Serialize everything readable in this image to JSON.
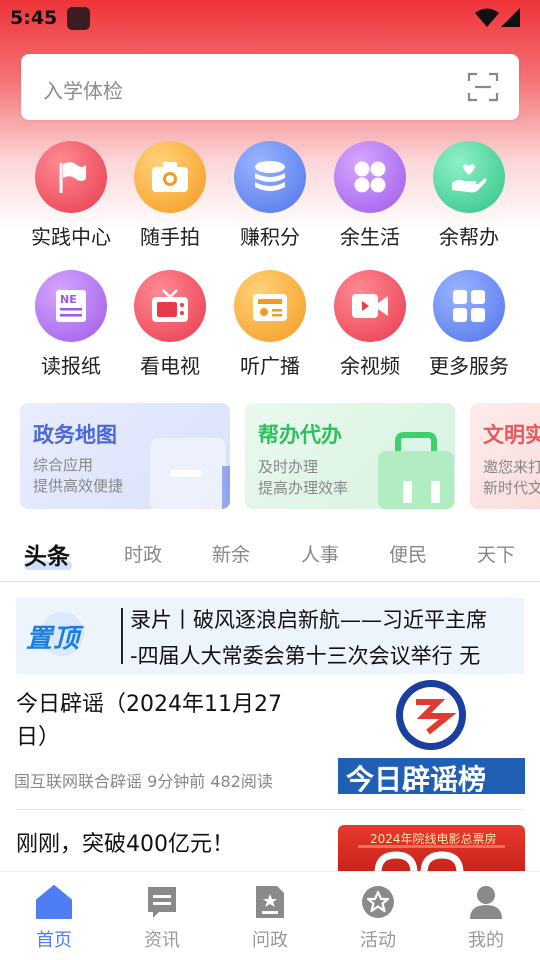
{
  "status_bar": {
    "time": "5:45"
  },
  "search": {
    "placeholder": "入学体检"
  },
  "services": [
    {
      "label": "实践中心",
      "icon": "flag-icon",
      "color": "#f0505f"
    },
    {
      "label": "随手拍",
      "icon": "camera-icon",
      "color": "#f9a932"
    },
    {
      "label": "赚积分",
      "icon": "coins-icon",
      "color": "#5c83f1"
    },
    {
      "label": "余生活",
      "icon": "clover-icon",
      "color": "#b06ff0"
    },
    {
      "label": "余帮办",
      "icon": "heart-hand-icon",
      "color": "#3fcf95"
    },
    {
      "label": "读报纸",
      "icon": "newspaper-icon",
      "color": "#b06ff0"
    },
    {
      "label": "看电视",
      "icon": "tv-icon",
      "color": "#f0505f"
    },
    {
      "label": "听广播",
      "icon": "radio-icon",
      "color": "#f9a932"
    },
    {
      "label": "余视频",
      "icon": "video-icon",
      "color": "#f0505f"
    },
    {
      "label": "更多服务",
      "icon": "grid-icon",
      "color": "#5c83f1"
    }
  ],
  "cards": [
    {
      "title": "政务地图",
      "sub1": "综合应用",
      "sub2": "提供高效便捷",
      "color": "#4a66d8"
    },
    {
      "title": "帮办代办",
      "sub1": "及时办理",
      "sub2": "提高办理效率",
      "color": "#2fbf5d"
    },
    {
      "title": "文明实",
      "sub1": "邀您来打",
      "sub2": "新时代文",
      "color": "#e55a5a"
    }
  ],
  "tabs": [
    "头条",
    "时政",
    "新余",
    "人事",
    "便民",
    "天下"
  ],
  "pinned": {
    "badge": "置顶",
    "line1": "录片丨破风逐浪启新航——习近平主席",
    "line2": "-四届人大常委会第十三次会议举行 无"
  },
  "news": [
    {
      "title": "今日辟谣（2024年11月27日）",
      "meta": "国互联网联合辟谣 9分钟前 482阅读",
      "image_caption": "今日辟谣榜"
    },
    {
      "title": "刚刚，突破400亿元！",
      "image_caption": "2024年院线电影总票房"
    }
  ],
  "bottom_nav": [
    {
      "label": "首页",
      "icon": "home-icon"
    },
    {
      "label": "资讯",
      "icon": "news-icon"
    },
    {
      "label": "问政",
      "icon": "inquiry-icon"
    },
    {
      "label": "活动",
      "icon": "activity-icon"
    },
    {
      "label": "我的",
      "icon": "profile-icon"
    }
  ],
  "accent_color": "#4f7df3"
}
